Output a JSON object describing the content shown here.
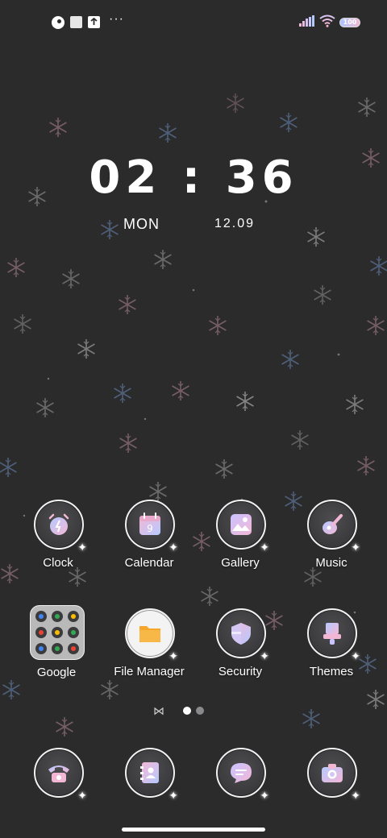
{
  "status_bar": {
    "dots": "···",
    "battery": "100",
    "icons": [
      "notification-bubble-icon",
      "screenshot-icon",
      "upload-icon",
      "more-icon",
      "signal-icon",
      "wifi-icon",
      "battery-icon"
    ]
  },
  "clock": {
    "time": "02 : 36",
    "day": "MON",
    "date": "12.09"
  },
  "row1": [
    {
      "label": "Clock",
      "icon": "alarm-clock-icon"
    },
    {
      "label": "Calendar",
      "icon": "calendar-icon"
    },
    {
      "label": "Gallery",
      "icon": "gallery-icon"
    },
    {
      "label": "Music",
      "icon": "music-icon"
    }
  ],
  "row2": [
    {
      "label": "Google",
      "icon": "google-folder-icon"
    },
    {
      "label": "File Manager",
      "icon": "folder-icon"
    },
    {
      "label": "Security",
      "icon": "shield-icon"
    },
    {
      "label": "Themes",
      "icon": "themes-icon"
    }
  ],
  "dock": [
    {
      "icon": "phone-icon"
    },
    {
      "icon": "contacts-icon"
    },
    {
      "icon": "messages-icon"
    },
    {
      "icon": "camera-icon"
    }
  ],
  "page_indicator": {
    "pages": 2,
    "active": 0
  },
  "colors": {
    "background": "#2b2b2c",
    "icon_pink": "#f3b7d6",
    "icon_blue": "#b6c9ff",
    "folder_orange": "#f6a62a"
  }
}
